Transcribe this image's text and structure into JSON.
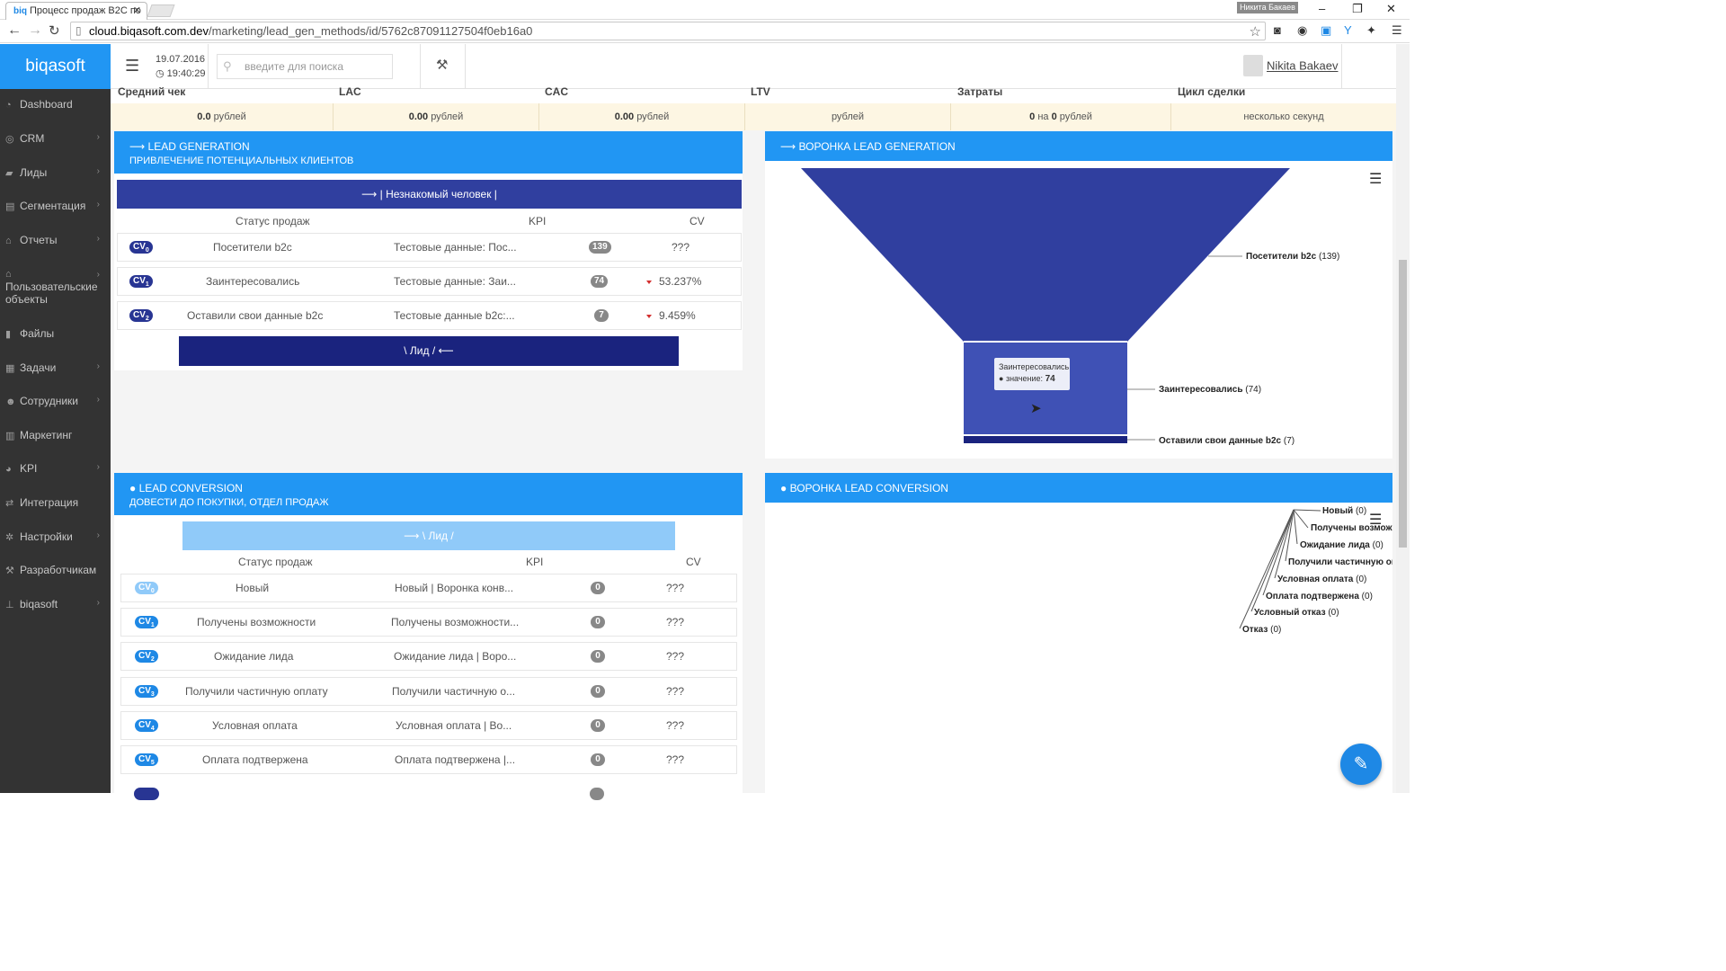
{
  "browser": {
    "tab_title": "Процесс продаж B2C по",
    "tab_favicon": "biq",
    "user_chip": "Никита Бакаев",
    "url_host": "cloud.biqasoft.com.dev",
    "url_path": "/marketing/lead_gen_methods/id/5762c87091127504f0eb16a0"
  },
  "header": {
    "logo": "biqasoft",
    "date": "19.07.2016",
    "time": "19:40:29",
    "search_placeholder": "введите для поиска",
    "user_name": "Nikita Bakaev"
  },
  "sidebar": {
    "items": [
      {
        "label": "Dashboard",
        "icon": "dashboard-icon",
        "has_children": false
      },
      {
        "label": "CRM",
        "icon": "crm-icon",
        "has_children": true
      },
      {
        "label": "Лиды",
        "icon": "chat-icon",
        "has_children": true
      },
      {
        "label": "Сегментация",
        "icon": "segment-icon",
        "has_children": true
      },
      {
        "label": "Отчеты",
        "icon": "bank-icon",
        "has_children": true
      },
      {
        "label": "Пользовательские объекты",
        "icon": "bank-icon",
        "has_children": true
      },
      {
        "label": "Файлы",
        "icon": "file-icon",
        "has_children": false
      },
      {
        "label": "Задачи",
        "icon": "tasks-icon",
        "has_children": true
      },
      {
        "label": "Сотрудники",
        "icon": "users-icon",
        "has_children": true
      },
      {
        "label": "Маркетинг",
        "icon": "chart-icon",
        "has_children": false
      },
      {
        "label": "KPI",
        "icon": "kpi-icon",
        "has_children": true
      },
      {
        "label": "Интеграция",
        "icon": "exchange-icon",
        "has_children": false
      },
      {
        "label": "Настройки",
        "icon": "gear-icon",
        "has_children": true
      },
      {
        "label": "Разработчикам",
        "icon": "wrench-icon",
        "has_children": false
      },
      {
        "label": "biqasoft",
        "icon": "pin-icon",
        "has_children": true
      }
    ]
  },
  "summary": {
    "headers": [
      "Средний чек",
      "LAC",
      "CAC",
      "LTV",
      "Затраты",
      "Цикл сделки"
    ],
    "cells": [
      {
        "value": "0.0",
        "unit": "рублей"
      },
      {
        "value": "0.00",
        "unit": "рублей"
      },
      {
        "value": "0.00",
        "unit": "рублей"
      },
      {
        "value": "",
        "unit": "рублей"
      },
      {
        "value": "0",
        "mid": "на",
        "value2": "0",
        "unit": "рублей"
      },
      {
        "value": "",
        "unit": "несколько секунд"
      }
    ]
  },
  "lead_generation": {
    "title": "LEAD GENERATION",
    "subtitle": "ПРИВЛЕЧЕНИЕ ПОТЕНЦИАЛЬНЫХ КЛИЕНТОВ",
    "stage_in": "| Незнакомый человек |",
    "stage_out": "\\ Лид /",
    "col_status": "Статус продаж",
    "col_kpi": "KPI",
    "col_cv": "CV",
    "rows": [
      {
        "badge": "CV",
        "badge_sub": "0",
        "status": "Посетители b2c",
        "data": "Тестовые данные: Пос...",
        "kpi": "139",
        "cv": "???",
        "down": false
      },
      {
        "badge": "CV",
        "badge_sub": "1",
        "status": "Заинтересовались",
        "data": "Тестовые данные: Заи...",
        "kpi": "74",
        "cv": "53.237%",
        "down": true
      },
      {
        "badge": "CV",
        "badge_sub": "2",
        "status": "Оставили свои данные b2c",
        "data": "Тестовые данные b2c:...",
        "kpi": "7",
        "cv": "9.459%",
        "down": true
      }
    ]
  },
  "funnel_lead_generation": {
    "title": "ВОРОНКА LEAD GENERATION",
    "tooltip_title": "Заинтересовались",
    "tooltip_label": "значение:",
    "tooltip_value": "74"
  },
  "chart_data": [
    {
      "type": "funnel",
      "title": "ВОРОНКА LEAD GENERATION",
      "categories": [
        "Посетители b2c",
        "Заинтересовались",
        "Оставили свои данные b2c"
      ],
      "values": [
        139,
        74,
        7
      ],
      "colors": [
        "#303f9f",
        "#3f51b5",
        "#1a237e"
      ]
    },
    {
      "type": "funnel",
      "title": "ВОРОНКА LEAD CONVERSION",
      "categories": [
        "Новый",
        "Получены возможн",
        "Ожидание лида",
        "Получили частичную опла",
        "Условная оплата",
        "Оплата подтвержена",
        "Условный отказ",
        "Отказ"
      ],
      "values": [
        0,
        0,
        0,
        0,
        0,
        0,
        0,
        0
      ]
    }
  ],
  "lead_conversion": {
    "title": "LEAD CONVERSION",
    "subtitle": "ДОВЕСТИ ДО ПОКУПКИ, ОТДЕЛ ПРОДАЖ",
    "stage_in": "\\ Лид /",
    "col_status": "Статус продаж",
    "col_kpi": "KPI",
    "col_cv": "CV",
    "rows": [
      {
        "badge": "CV",
        "badge_sub": "0",
        "status": "Новый",
        "data": "Новый | Воронка конв...",
        "kpi": "0",
        "cv": "???",
        "light": true
      },
      {
        "badge": "CV",
        "badge_sub": "1",
        "status": "Получены возможности",
        "data": "Получены возможности...",
        "kpi": "0",
        "cv": "???",
        "light": false
      },
      {
        "badge": "CV",
        "badge_sub": "2",
        "status": "Ожидание лида",
        "data": "Ожидание лида | Воро...",
        "kpi": "0",
        "cv": "???",
        "light": false
      },
      {
        "badge": "CV",
        "badge_sub": "3",
        "status": "Получили частичную оплату",
        "data": "Получили частичную о...",
        "kpi": "0",
        "cv": "???",
        "light": false
      },
      {
        "badge": "CV",
        "badge_sub": "4",
        "status": "Условная оплата",
        "data": "Условная оплата | Во...",
        "kpi": "0",
        "cv": "???",
        "light": false
      },
      {
        "badge": "CV",
        "badge_sub": "5",
        "status": "Оплата подтвержена",
        "data": "Оплата подтвержена |...",
        "kpi": "0",
        "cv": "???",
        "light": false
      }
    ]
  },
  "funnel_lead_conversion": {
    "title": "ВОРОНКА LEAD CONVERSION"
  },
  "colors": {
    "primary": "#2196f3",
    "stage_dark": "#303f9f",
    "stage_darker": "#1a237e",
    "stage_light": "#90caf9",
    "badge_dark": "#283593",
    "badge_mid": "#1e88e5",
    "badge_light": "#90caf9",
    "sidebar_bg": "#333333",
    "summary_bg": "#fdf6e3"
  }
}
